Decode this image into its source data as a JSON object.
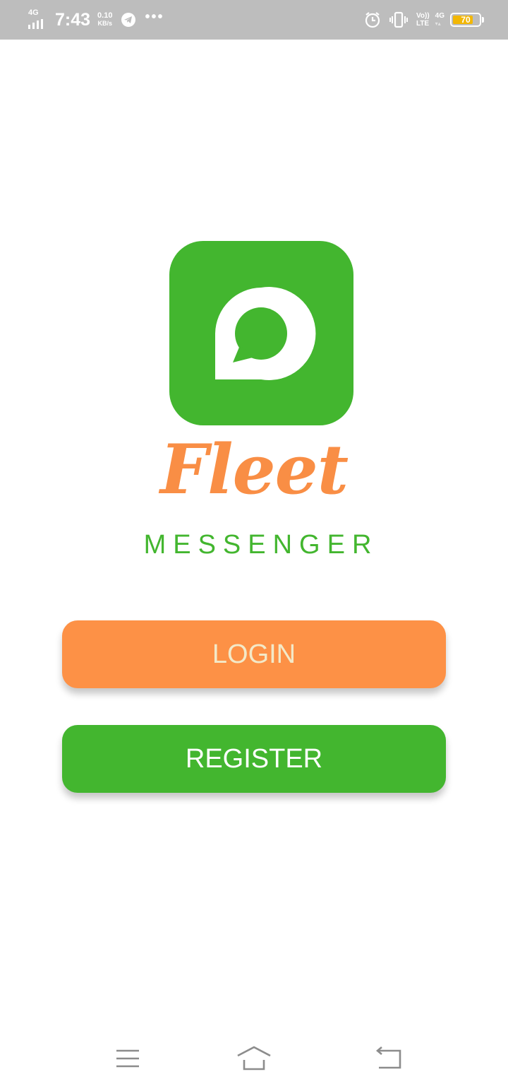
{
  "status_bar": {
    "network_type": "4G",
    "time": "7:43",
    "speed_value": "0.10",
    "speed_unit": "KB/s",
    "volte_top": "Vo))",
    "volte_bottom": "LTE",
    "network_right": "4G",
    "battery_level": "70",
    "icons": [
      "signal-icon",
      "telegram-icon",
      "more-dots-icon",
      "alarm-icon",
      "vibrate-icon",
      "battery-icon"
    ],
    "dots": "•••"
  },
  "app": {
    "brand_name": "Fleet",
    "brand_sub": "MESSENGER",
    "logo_icon": "chat-bubble-icon"
  },
  "buttons": {
    "login_label": "LOGIN",
    "register_label": "REGISTER"
  },
  "nav_bar": {
    "icons": [
      "menu-icon",
      "home-icon",
      "back-icon"
    ]
  },
  "colors": {
    "brand_green": "#43b62f",
    "brand_orange": "#fd9146",
    "status_bar_bg": "#bdbdbd",
    "battery_fill": "#f2b705"
  }
}
